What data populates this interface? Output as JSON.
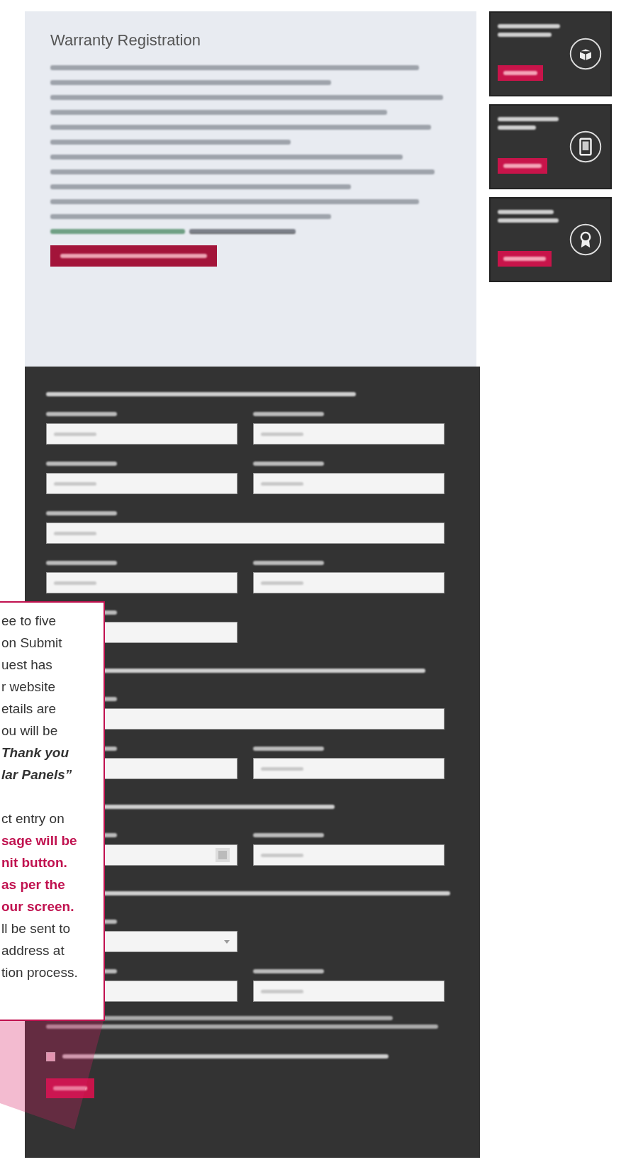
{
  "registration": {
    "title": "Warranty Registration",
    "paragraphs": [
      {
        "lines": [
          {
            "kind": "blurred"
          },
          {
            "kind": "blurred"
          }
        ]
      },
      {
        "lines": [
          {
            "kind": "blurred"
          },
          {
            "kind": "blurred"
          },
          {
            "kind": "blurred"
          },
          {
            "kind": "blurred"
          },
          {
            "kind": "blurred"
          },
          {
            "kind": "blurred"
          }
        ]
      },
      {
        "lines": [
          {
            "kind": "blurred"
          },
          {
            "kind": "blurred"
          },
          {
            "kind": "blurred"
          }
        ]
      },
      {
        "lines": [
          {
            "kind": "link"
          }
        ]
      }
    ],
    "button": {
      "kind": "blurred"
    }
  },
  "side_cards": [
    {
      "button": {
        "kind": "blurred"
      }
    },
    {
      "button": {
        "kind": "blurred"
      }
    },
    {
      "button": {
        "kind": "blurred"
      }
    }
  ],
  "form": {
    "rows": [
      {
        "kind": "heading"
      },
      {
        "kind": "fields",
        "fields": [
          {
            "kind": "input"
          },
          {
            "kind": "input"
          }
        ]
      },
      {
        "kind": "fields",
        "fields": [
          {
            "kind": "input"
          },
          {
            "kind": "input"
          }
        ]
      },
      {
        "kind": "fields",
        "fields": [
          {
            "kind": "wide_input"
          }
        ]
      },
      {
        "kind": "fields",
        "fields": [
          {
            "kind": "input"
          },
          {
            "kind": "input"
          }
        ]
      },
      {
        "kind": "fields",
        "fields": [
          {
            "kind": "input"
          }
        ]
      },
      {
        "kind": "heading"
      },
      {
        "kind": "fields",
        "fields": [
          {
            "kind": "wide_input"
          }
        ]
      },
      {
        "kind": "fields",
        "fields": [
          {
            "kind": "input"
          },
          {
            "kind": "input"
          }
        ]
      },
      {
        "kind": "heading"
      },
      {
        "kind": "fields",
        "fields": [
          {
            "kind": "date"
          },
          {
            "kind": "input"
          }
        ]
      },
      {
        "kind": "heading"
      },
      {
        "kind": "fields",
        "fields": [
          {
            "kind": "select"
          }
        ]
      },
      {
        "kind": "fields",
        "fields": [
          {
            "kind": "input"
          },
          {
            "kind": "input"
          }
        ]
      },
      {
        "kind": "notice"
      },
      {
        "kind": "checkbox",
        "checked": false
      },
      {
        "kind": "submit"
      }
    ]
  },
  "callout": {
    "lines": [
      {
        "kind": "normal",
        "text": "ee to five"
      },
      {
        "kind": "normal",
        "text": "on Submit"
      },
      {
        "kind": "normal",
        "text": "uest has"
      },
      {
        "kind": "normal",
        "text": "r website"
      },
      {
        "kind": "normal",
        "text": "etails are"
      },
      {
        "kind": "normal",
        "text": "ou will be"
      },
      {
        "kind": "emphasis",
        "text": "Thank you"
      },
      {
        "kind": "emphasis",
        "text": "lar Panels”"
      },
      {
        "kind": "gap"
      },
      {
        "kind": "normal",
        "text": "ct entry on"
      },
      {
        "kind": "alert",
        "text": "sage will be"
      },
      {
        "kind": "alert",
        "text": "nit button."
      },
      {
        "kind": "alert",
        "text": "as per the"
      },
      {
        "kind": "alert",
        "text": "our screen."
      },
      {
        "kind": "normal",
        "text": "ll be sent to"
      },
      {
        "kind": "normal",
        "text": "address at"
      },
      {
        "kind": "normal",
        "text": "tion process."
      }
    ]
  }
}
